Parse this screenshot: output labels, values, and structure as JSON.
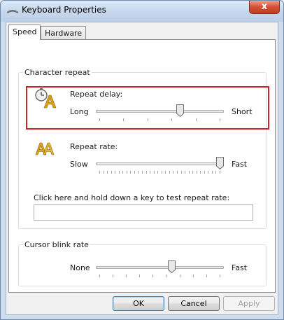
{
  "window": {
    "title": "Keyboard Properties",
    "close_glyph": "x"
  },
  "tabs": [
    {
      "label": "Speed",
      "active": true
    },
    {
      "label": "Hardware",
      "active": false
    }
  ],
  "character_repeat": {
    "group_label": "Character repeat",
    "repeat_delay": {
      "label": "Repeat delay:",
      "min_label": "Long",
      "max_label": "Short",
      "value_fraction": 0.67,
      "icon": "repeat-delay-icon"
    },
    "repeat_rate": {
      "label": "Repeat rate:",
      "min_label": "Slow",
      "max_label": "Fast",
      "value_fraction": 1.0,
      "icon": "repeat-rate-icon"
    },
    "test_prompt": "Click here and hold down a key to test repeat rate:",
    "test_value": ""
  },
  "cursor_blink": {
    "group_label": "Cursor blink rate",
    "min_label": "None",
    "max_label": "Fast",
    "value_fraction": 0.6
  },
  "buttons": {
    "ok": "OK",
    "cancel": "Cancel",
    "apply": "Apply"
  },
  "colors": {
    "highlight": "#d4202a",
    "titlebar": "#c6d7ec",
    "close": "#c33a1f"
  }
}
